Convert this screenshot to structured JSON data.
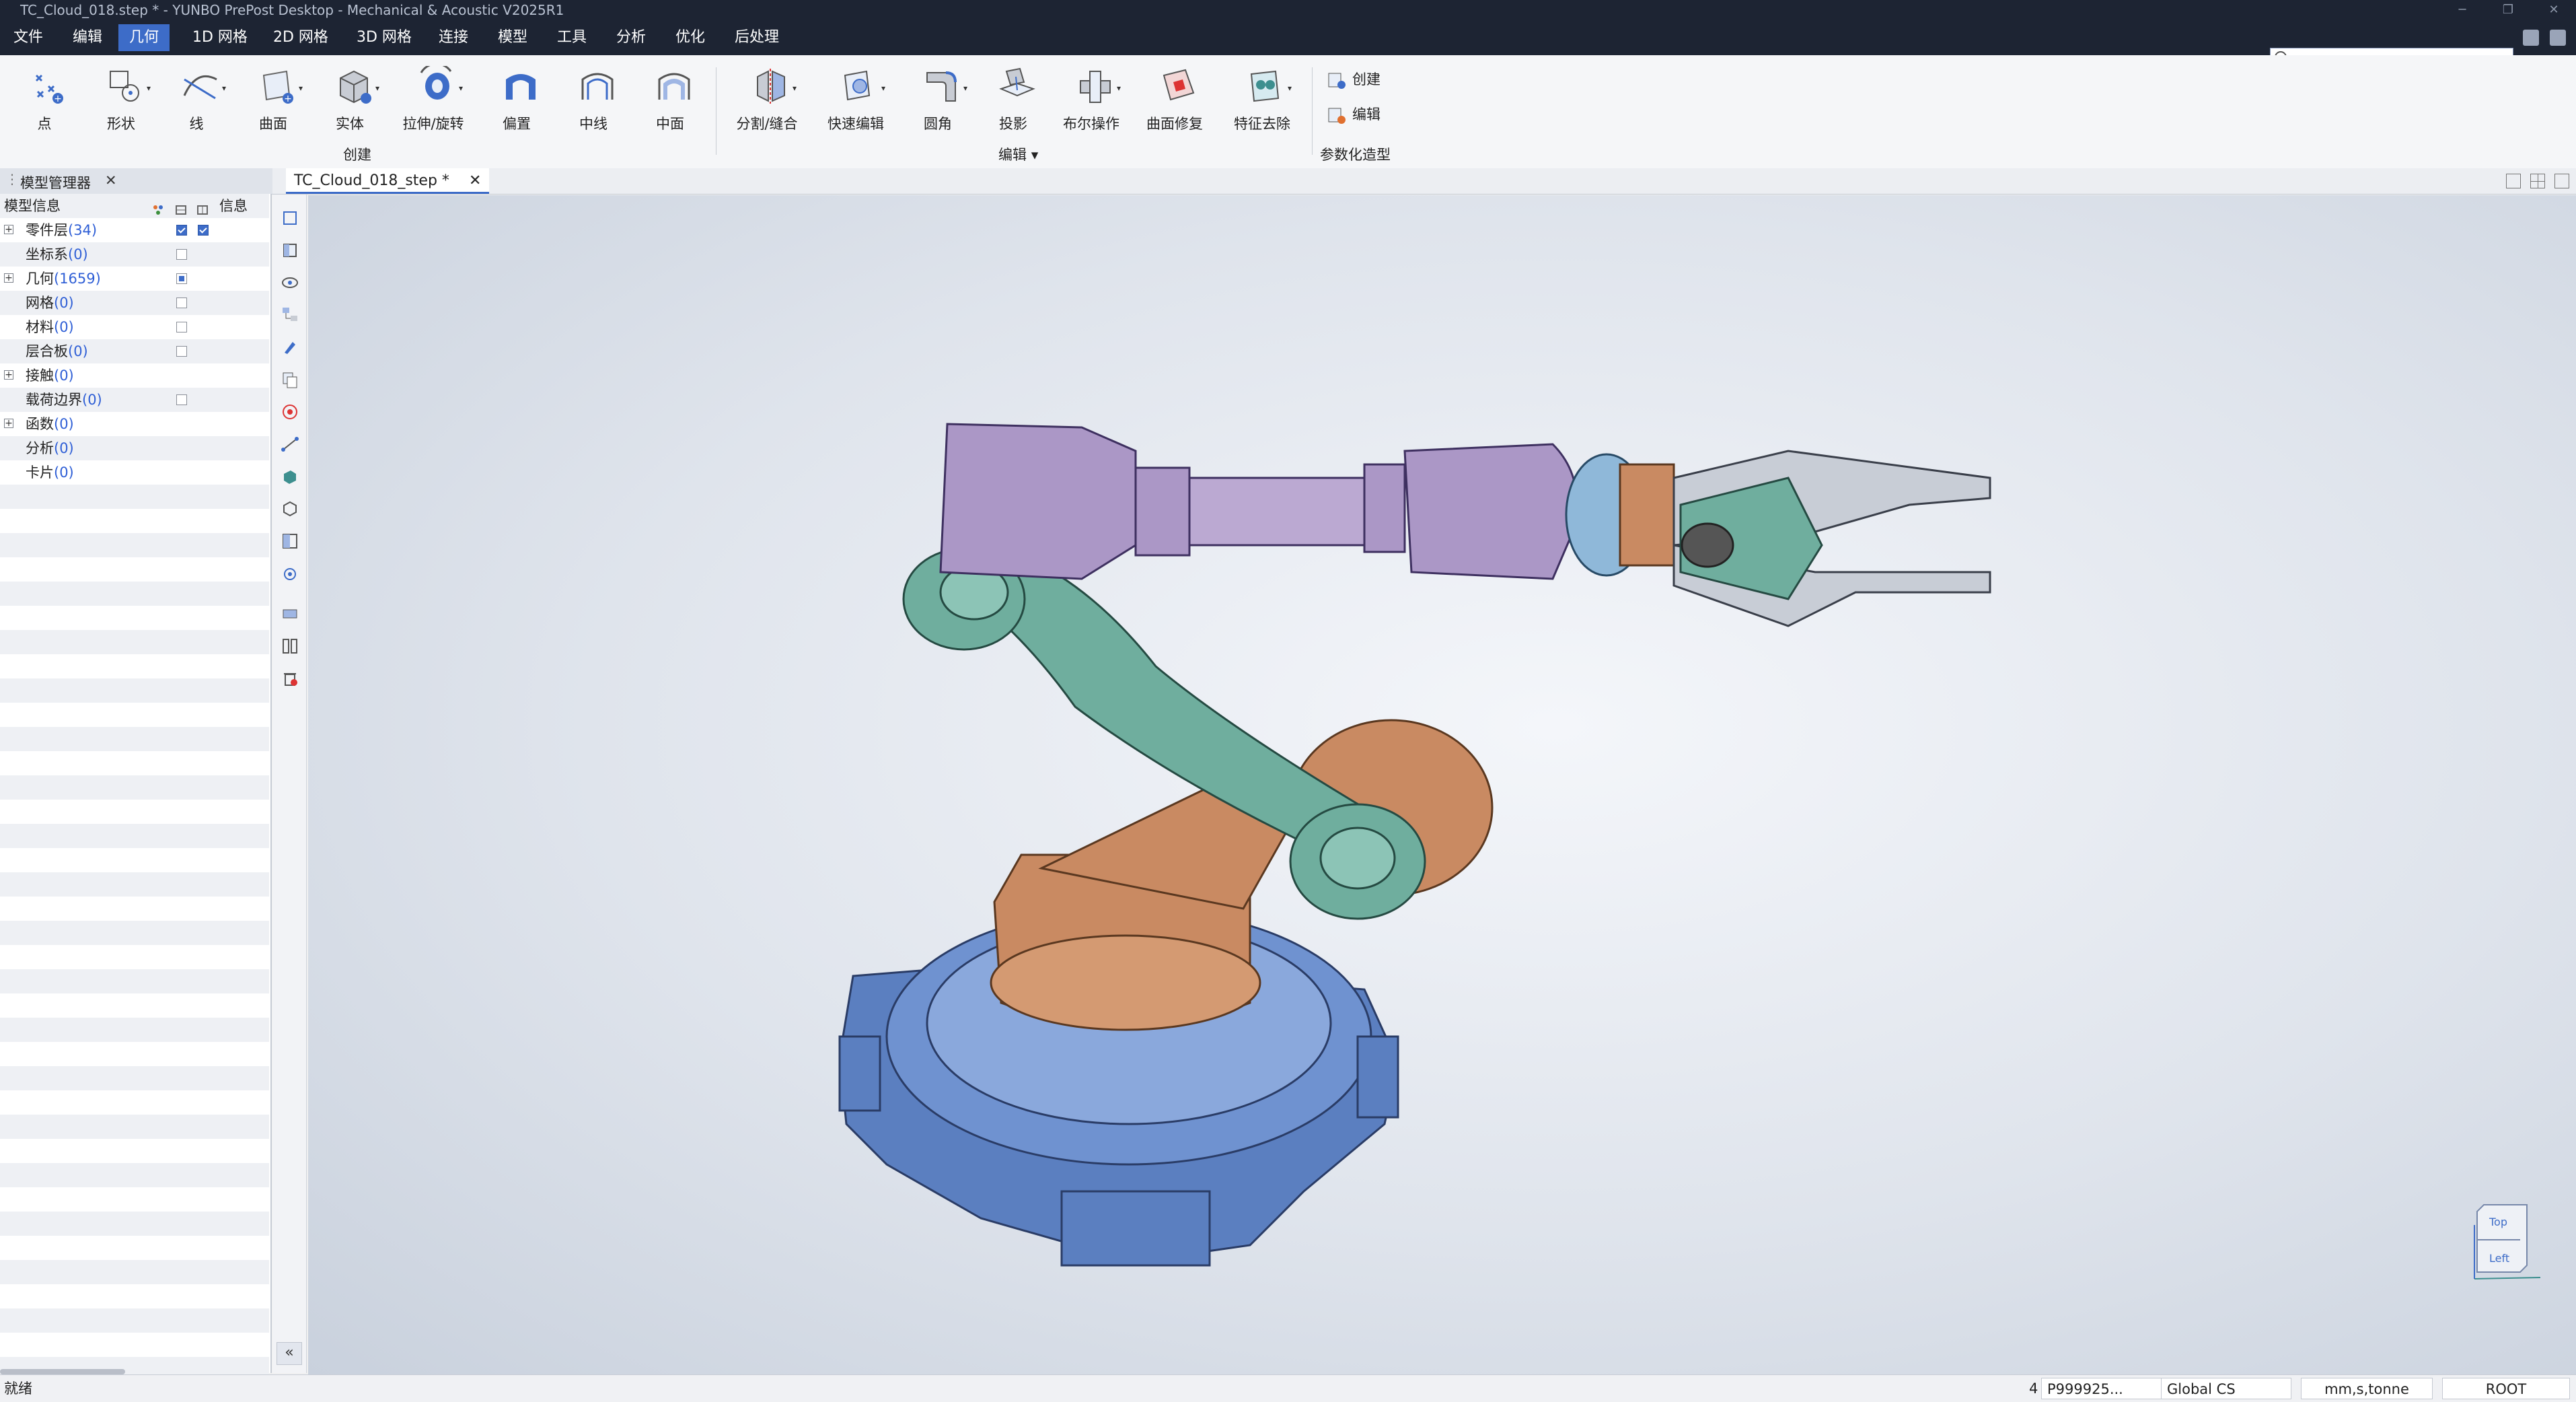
{
  "window": {
    "title": "TC_Cloud_018.step * - YUNBO PrePost Desktop - Mechanical & Acoustic V2025R1"
  },
  "menu": {
    "items": [
      "文件",
      "编辑",
      "几何",
      "1D 网格",
      "2D 网格",
      "3D 网格",
      "连接",
      "模型",
      "工具",
      "分析",
      "优化",
      "后处理"
    ],
    "active": "几何"
  },
  "ribbon": {
    "create": {
      "label": "创建",
      "tools": [
        "点",
        "形状",
        "线",
        "曲面",
        "实体",
        "拉伸/旋转",
        "偏置",
        "中线",
        "中面"
      ]
    },
    "edit": {
      "label": "编辑",
      "tools": [
        "分割/缝合",
        "快速编辑",
        "圆角",
        "投影",
        "布尔操作",
        "曲面修复",
        "特征去除"
      ]
    },
    "param": {
      "label": "参数化造型",
      "tools": [
        "创建",
        "编辑"
      ]
    }
  },
  "panel": {
    "tab_label": "模型管理器",
    "header": {
      "col1": "模型信息",
      "col2": "信息"
    },
    "rows": [
      {
        "name": "零件层",
        "count": "(34)",
        "expand": "+",
        "chk1": "on",
        "chk2": "on"
      },
      {
        "name": "坐标系",
        "count": "(0)",
        "expand": "",
        "chk1": "off",
        "chk2": ""
      },
      {
        "name": "几何",
        "count": "(1659)",
        "expand": "+",
        "chk1": "part",
        "chk2": ""
      },
      {
        "name": "网格",
        "count": "(0)",
        "expand": "",
        "chk1": "off",
        "chk2": ""
      },
      {
        "name": "材料",
        "count": "(0)",
        "expand": "",
        "chk1": "off",
        "chk2": ""
      },
      {
        "name": "层合板",
        "count": "(0)",
        "expand": "",
        "chk1": "off",
        "chk2": ""
      },
      {
        "name": "接触",
        "count": "(0)",
        "expand": "+",
        "chk1": "",
        "chk2": ""
      },
      {
        "name": "载荷边界",
        "count": "(0)",
        "expand": "",
        "chk1": "off",
        "chk2": ""
      },
      {
        "name": "函数",
        "count": "(0)",
        "expand": "+",
        "chk1": "",
        "chk2": ""
      },
      {
        "name": "分析",
        "count": "(0)",
        "expand": "",
        "chk1": "",
        "chk2": ""
      },
      {
        "name": "卡片",
        "count": "(0)",
        "expand": "",
        "chk1": "",
        "chk2": ""
      }
    ]
  },
  "document": {
    "tab_label": "TC_Cloud_018_step *"
  },
  "viewcube": {
    "top": "Top",
    "left": "Left"
  },
  "status": {
    "left": "就绪",
    "count": "4",
    "part": "P999925...",
    "cs": "Global CS",
    "units": "mm,s,tonne",
    "root": "ROOT"
  },
  "colors": {
    "base": "#5b7fc0",
    "turret": "#c98a62",
    "lower_arm": "#6fae9e",
    "upper_arm": "#ab97c6",
    "gripper": "#8fb8d9",
    "accent": "#3d6cc8"
  }
}
